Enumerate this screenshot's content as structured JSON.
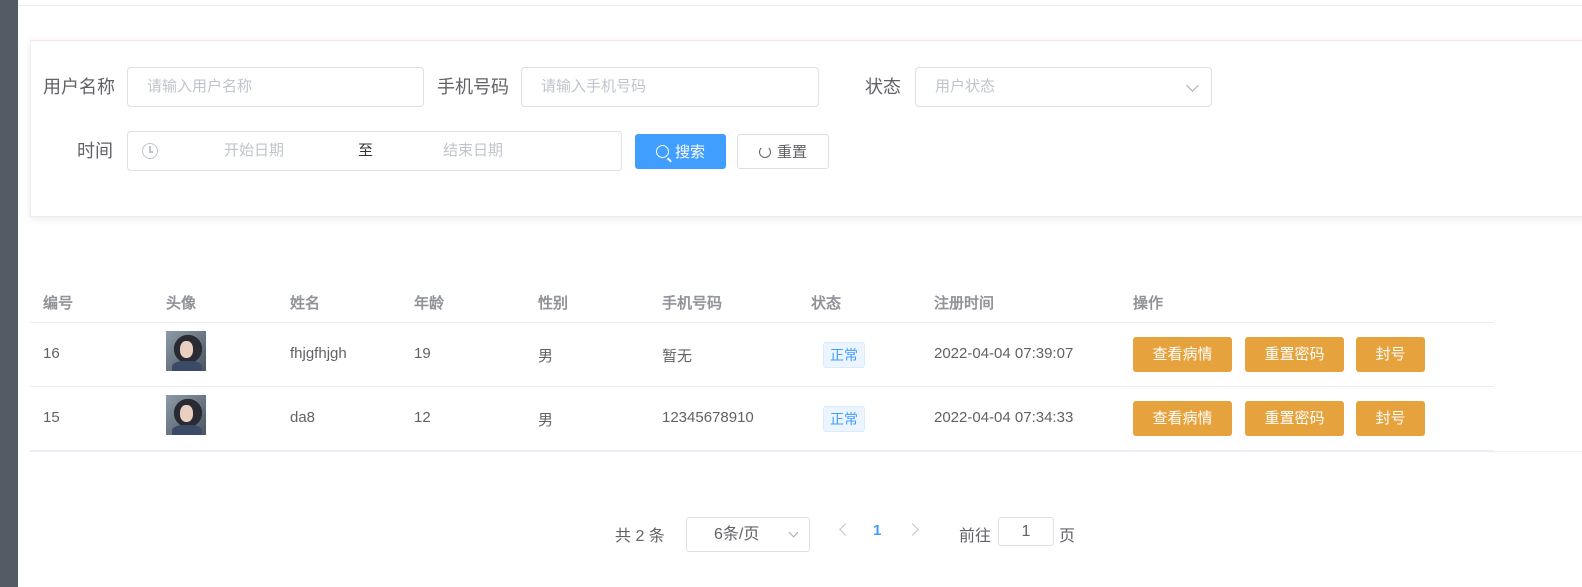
{
  "filters": {
    "username_label": "用户名称",
    "username_placeholder": "请输入用户名称",
    "phone_label": "手机号码",
    "phone_placeholder": "请输入手机号码",
    "status_label": "状态",
    "status_placeholder": "用户状态",
    "time_label": "时间",
    "start_placeholder": "开始日期",
    "range_separator": "至",
    "end_placeholder": "结束日期",
    "search_label": "搜索",
    "reset_label": "重置"
  },
  "table": {
    "columns": [
      "编号",
      "头像",
      "姓名",
      "年龄",
      "性别",
      "手机号码",
      "状态",
      "注册时间",
      "操作"
    ],
    "rows": [
      {
        "id": "16",
        "name": "fhjgfhjgh",
        "age": "19",
        "gender": "男",
        "phone": "暂无",
        "status": "正常",
        "registered": "2022-04-04 07:39:07"
      },
      {
        "id": "15",
        "name": "da8",
        "age": "12",
        "gender": "男",
        "phone": "12345678910",
        "status": "正常",
        "registered": "2022-04-04 07:34:33"
      }
    ],
    "actions": {
      "view": "查看病情",
      "reset_password": "重置密码",
      "ban": "封号"
    }
  },
  "pagination": {
    "total_text": "共 2 条",
    "page_size": "6条/页",
    "current_page": "1",
    "goto_prefix": "前往",
    "goto_value": "1",
    "goto_suffix": "页"
  },
  "colors": {
    "primary": "#409eff",
    "warning": "#e6a23c",
    "sidebar": "#545b64"
  }
}
